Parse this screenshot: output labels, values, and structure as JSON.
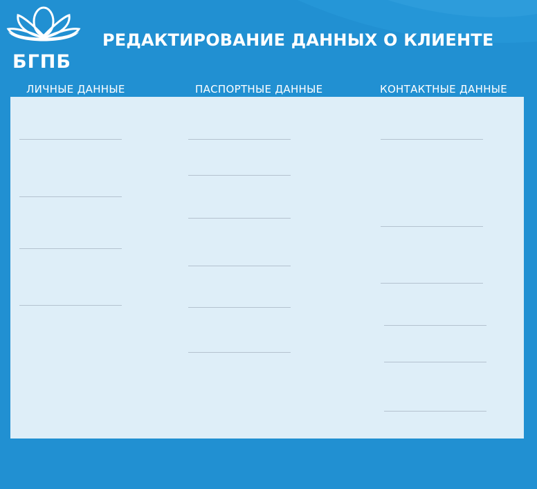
{
  "brand": {
    "name": "БГПБ",
    "primary_color": "#2190d2",
    "panel_color": "#deeef8",
    "logo_icon": "lotus-flower-icon"
  },
  "header": {
    "title": "РЕДАКТИРОВАНИЕ ДАННЫХ О КЛИЕНТЕ"
  },
  "sections": {
    "personal": {
      "label": "ЛИЧНЫЕ ДАННЫЕ",
      "field_count": 4
    },
    "passport": {
      "label": "ПАСПОРТНЫЕ ДАННЫЕ",
      "field_count": 6
    },
    "contact": {
      "label": "КОНТАКТНЫЕ ДАННЫЕ",
      "field_count": 6
    }
  }
}
